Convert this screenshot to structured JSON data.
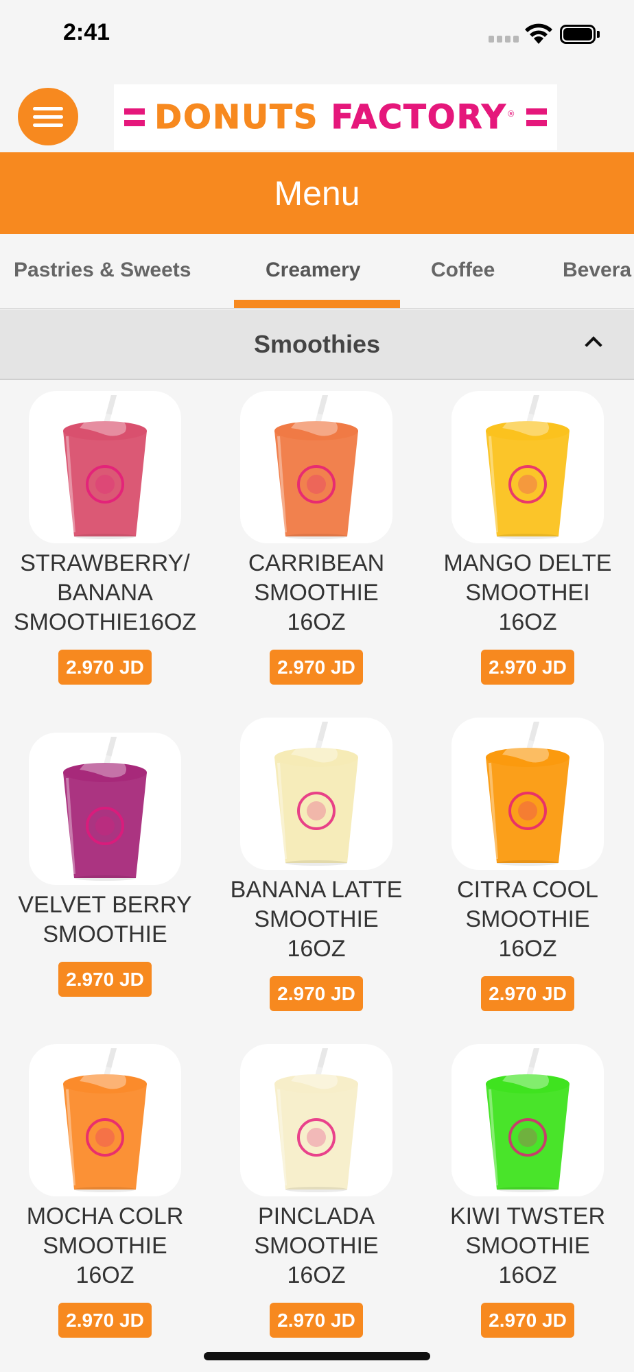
{
  "status_bar": {
    "time": "2:41"
  },
  "header": {
    "logo_word1": "DONUTS",
    "logo_word2": "FACTORY",
    "logo_mark": "®"
  },
  "menu": {
    "title": "Menu"
  },
  "tabs": [
    {
      "label": "Pastries & Sweets",
      "active": false
    },
    {
      "label": "Creamery",
      "active": true
    },
    {
      "label": "Coffee",
      "active": false
    },
    {
      "label": "Bevera",
      "active": false
    }
  ],
  "section": {
    "title": "Smoothies",
    "expanded": true
  },
  "products": [
    {
      "name_lines": [
        "STRAWBERRY/",
        "BANANA",
        "SMOOTHIE16OZ"
      ],
      "price": "2.970 JD",
      "color": "#d9506e"
    },
    {
      "name_lines": [
        "CARRIBEAN",
        "SMOOTHIE",
        "16OZ"
      ],
      "price": "2.970 JD",
      "color": "#f07a45"
    },
    {
      "name_lines": [
        "MANGO DELTE",
        "SMOOTHEI",
        "16OZ"
      ],
      "price": "2.970 JD",
      "color": "#fbc21e"
    },
    {
      "name_lines": [
        "VELVET BERRY",
        "SMOOTHIE"
      ],
      "price": "2.970 JD",
      "color": "#a7297a"
    },
    {
      "name_lines": [
        "BANANA LATTE",
        "SMOOTHIE",
        "16OZ"
      ],
      "price": "2.970 JD",
      "color": "#f6ebb6"
    },
    {
      "name_lines": [
        "CITRA COOL",
        "SMOOTHIE",
        "16OZ"
      ],
      "price": "2.970 JD",
      "color": "#fb9a0e"
    },
    {
      "name_lines": [
        "MOCHA COLR",
        "SMOOTHIE",
        "16OZ"
      ],
      "price": "2.970 JD",
      "color": "#fb8b2b"
    },
    {
      "name_lines": [
        "PINCLADA",
        "SMOOTHIE",
        "16OZ"
      ],
      "price": "2.970 JD",
      "color": "#f7eec9"
    },
    {
      "name_lines": [
        "KIWI TWSTER",
        "SMOOTHIE",
        "16OZ"
      ],
      "price": "2.970 JD",
      "color": "#3fe31f"
    }
  ]
}
